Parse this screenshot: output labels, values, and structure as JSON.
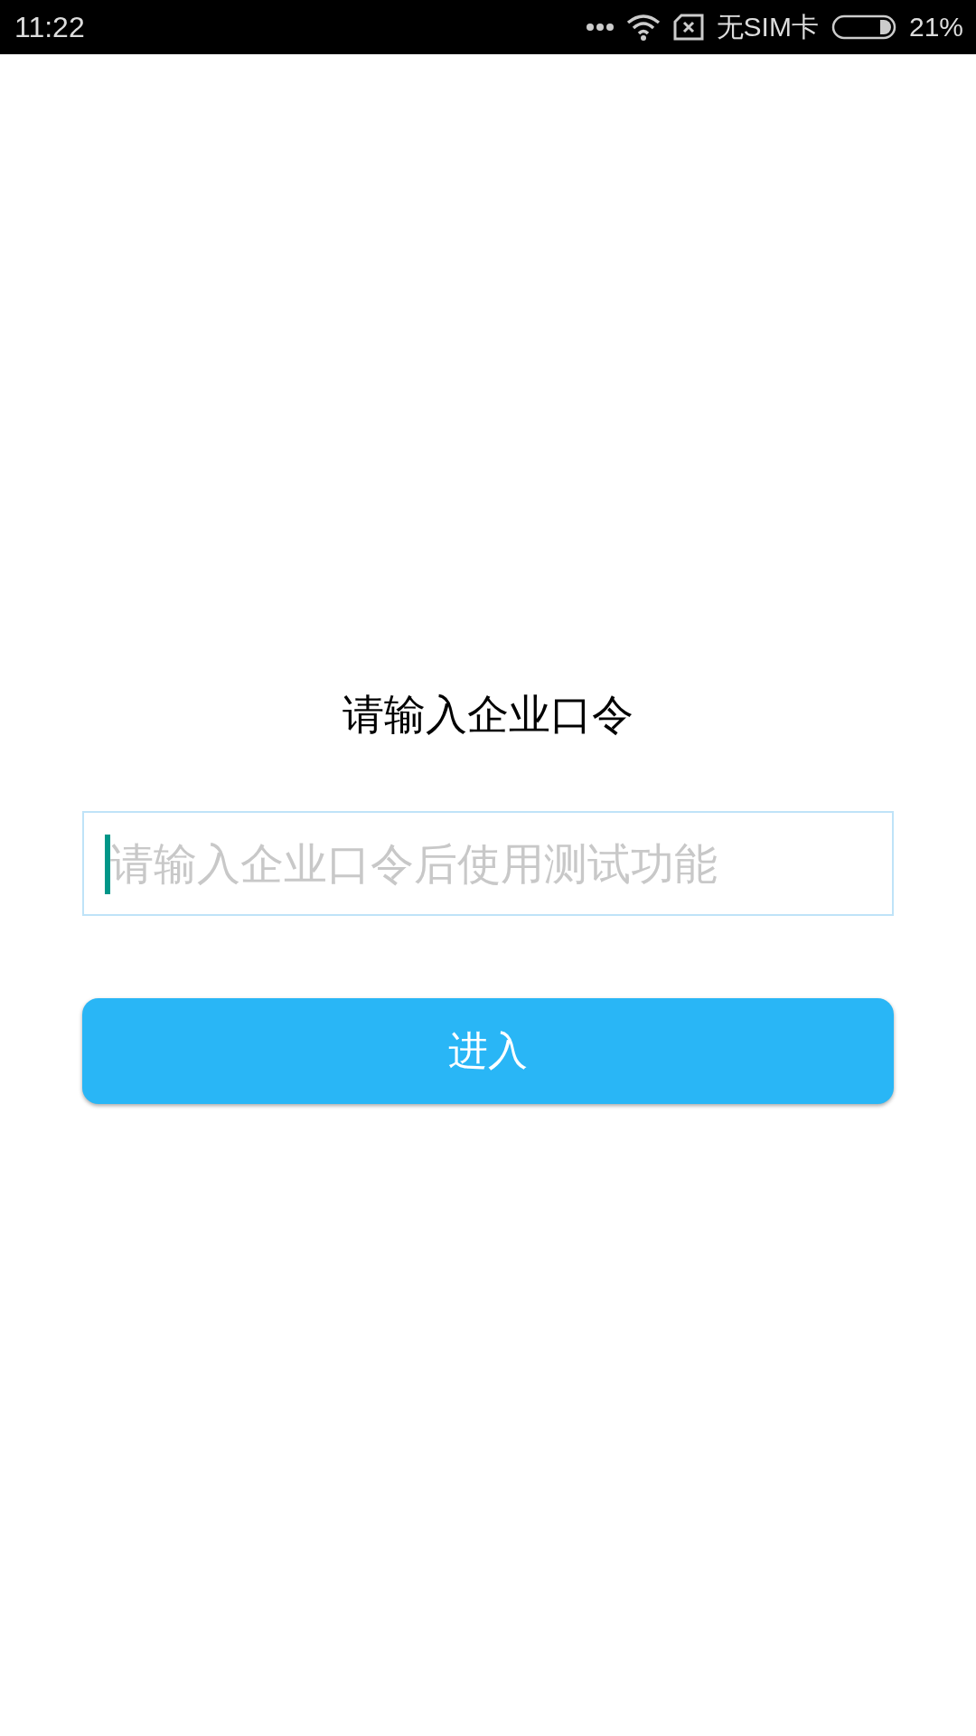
{
  "status_bar": {
    "time": "11:22",
    "carrier": "无SIM卡",
    "battery": "21%"
  },
  "title": "请输入企业口令",
  "code_field": {
    "placeholder": "请输入企业口令后使用测试功能",
    "focused": true
  },
  "enter_button": {
    "label": "进入"
  }
}
